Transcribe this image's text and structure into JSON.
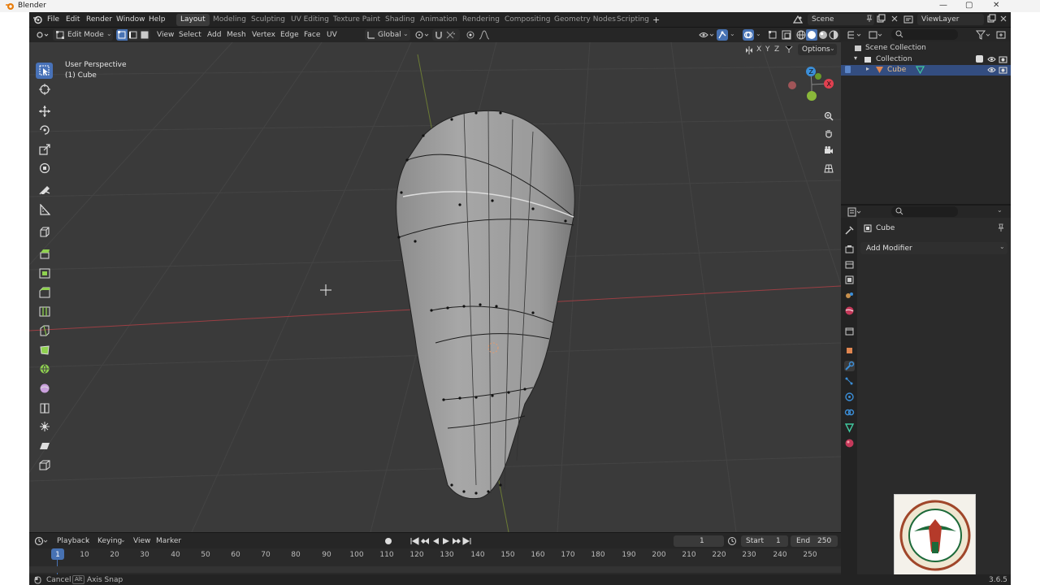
{
  "window": {
    "title": "Blender",
    "minimize": "—",
    "maximize": "▢",
    "close": "✕"
  },
  "menubar": {
    "menus": [
      "File",
      "Edit",
      "Render",
      "Window",
      "Help"
    ],
    "workspaces": [
      "Layout",
      "Modeling",
      "Sculpting",
      "UV Editing",
      "Texture Paint",
      "Shading",
      "Animation",
      "Rendering",
      "Compositing",
      "Geometry Nodes",
      "Scripting"
    ],
    "add_tab": "+",
    "scene": "Scene",
    "view_layer": "ViewLayer"
  },
  "viewport_header": {
    "mode": "Edit Mode",
    "menus": [
      "View",
      "Select",
      "Add",
      "Mesh",
      "Vertex",
      "Edge",
      "Face",
      "UV"
    ],
    "orientation": "Global",
    "axes": [
      "X",
      "Y",
      "Z"
    ],
    "options": "Options"
  },
  "viewport": {
    "perspective": "User Perspective",
    "object": "(1) Cube",
    "gizmo": {
      "z": "Z",
      "y": "Y",
      "x": "X"
    }
  },
  "outliner": {
    "scene_collection": "Scene Collection",
    "collection": "Collection",
    "object": "Cube"
  },
  "properties": {
    "object_name": "Cube",
    "add_modifier": "Add Modifier"
  },
  "timeline": {
    "menus": [
      "Playback",
      "Keying",
      "View",
      "Marker"
    ],
    "current_frame": "1",
    "start_label": "Start",
    "start": "1",
    "end_label": "End",
    "end": "250",
    "ticks": [
      "1",
      "10",
      "20",
      "30",
      "40",
      "50",
      "60",
      "70",
      "80",
      "90",
      "100",
      "110",
      "120",
      "130",
      "140",
      "150",
      "160",
      "170",
      "180",
      "190",
      "200",
      "210",
      "220",
      "230",
      "240",
      "250"
    ]
  },
  "statusbar": {
    "cancel": "Cancel",
    "alt_key": "Alt",
    "axis_snap": "Axis Snap",
    "version": "3.6.5"
  },
  "colors": {
    "accent": "#4772b3",
    "x_axis": "#e04050",
    "y_axis": "#8ab83a",
    "z_axis": "#3b8ed8",
    "modifier_wrench": "#3b8ed8"
  }
}
